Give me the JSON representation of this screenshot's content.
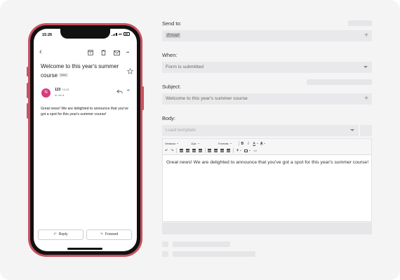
{
  "phone": {
    "status_time": "15:26",
    "network": "4G",
    "subject": "Welcome to this year's summer course",
    "inbox_tag": "Inbox",
    "avatar_letter": "N",
    "sender": "123",
    "sent_time": "15:25",
    "to_me": "to me ▾",
    "body": "Great news! We are delighted to announce that you've got a spot for this year's summer course!",
    "reply_label": "Reply",
    "forward_label": "Forward"
  },
  "form": {
    "send_to_label": "Send to:",
    "send_to_value": "Email",
    "when_label": "When:",
    "when_value": "Form is submitted",
    "subject_label": "Subject:",
    "subject_value": "Welcome to this year's summer course",
    "body_label": "Body:",
    "template_placeholder": "Load template",
    "editor": {
      "font": "Verdana",
      "size": "11pt",
      "formats": "Formats",
      "bold": "B",
      "italic": "I",
      "font_color": "A",
      "bg_color": "A",
      "content": "Great news! We are delighted to announce that you've got a spot for this year's summer course!"
    }
  },
  "icons": {
    "add": "+",
    "back": "‹",
    "more": "•••"
  },
  "colors": {
    "phone_frame": "#c9515f",
    "avatar": "#d8397f",
    "canvas": "#f4f4f5",
    "field": "#e9e9eb"
  }
}
